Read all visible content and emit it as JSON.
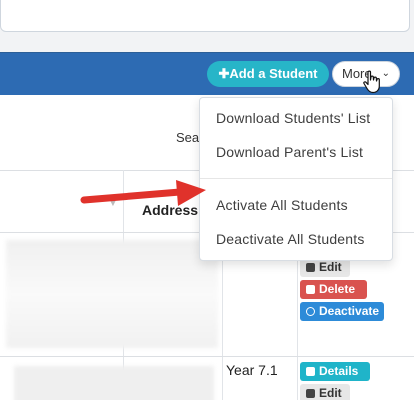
{
  "header": {
    "add_student_label": "Add a Student",
    "more_label": "More"
  },
  "dropdown": {
    "items": [
      {
        "label": "Download Students' List"
      },
      {
        "label": "Download Parent's List"
      },
      {
        "label": "Activate All Students"
      },
      {
        "label": "Deactivate All Students"
      }
    ]
  },
  "table": {
    "search_label": "Sea",
    "address_header": "Address",
    "row1": {
      "edit": "Edit",
      "delete": "Delete",
      "deactivate": "Deactivate"
    },
    "row2": {
      "year": "Year 7.1",
      "details": "Details",
      "edit": "Edit"
    }
  },
  "colors": {
    "header_blue": "#2d6bb3",
    "add_button": "#27b5c8",
    "annotation_arrow": "#e0322b"
  }
}
